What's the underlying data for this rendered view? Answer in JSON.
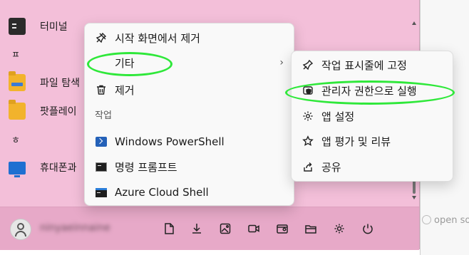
{
  "app_list": {
    "items": [
      {
        "label": "터미널",
        "icon": "terminal-icon"
      },
      {
        "letter": "ㅍ"
      },
      {
        "label": "파일 탐색",
        "icon": "file-explorer-icon"
      },
      {
        "label": "팟플레이",
        "icon": "folder-icon"
      },
      {
        "letter": "ㅎ"
      },
      {
        "label": "휴대폰과",
        "icon": "monitor-icon"
      }
    ]
  },
  "context_menu": {
    "unpin_label": "시작 화면에서 제거",
    "more_label": "기타",
    "more_arrow": "›",
    "uninstall_label": "제거",
    "tasks_section": "작업",
    "tasks": [
      {
        "label": "Windows PowerShell"
      },
      {
        "label": "명령 프롬프트"
      },
      {
        "label": "Azure Cloud Shell"
      }
    ]
  },
  "submenu": {
    "items": [
      {
        "label": "작업 표시줄에 고정",
        "icon": "pin-icon"
      },
      {
        "label": "관리자 권한으로 실행",
        "icon": "shield-icon"
      },
      {
        "label": "앱 설정",
        "icon": "gear-icon"
      },
      {
        "label": "앱 평가 및 리뷰",
        "icon": "star-icon"
      },
      {
        "label": "공유",
        "icon": "share-icon"
      }
    ]
  },
  "bottom_bar": {
    "user_name": "ninyaeinnaine"
  },
  "right_pane": {
    "text": "open so"
  },
  "colors": {
    "start_panel": "#f3bfd9",
    "bottom_bar": "#e7a9c8",
    "highlight_ellipse": "#2fe83a",
    "menu_bg": "#f9f9f9"
  }
}
